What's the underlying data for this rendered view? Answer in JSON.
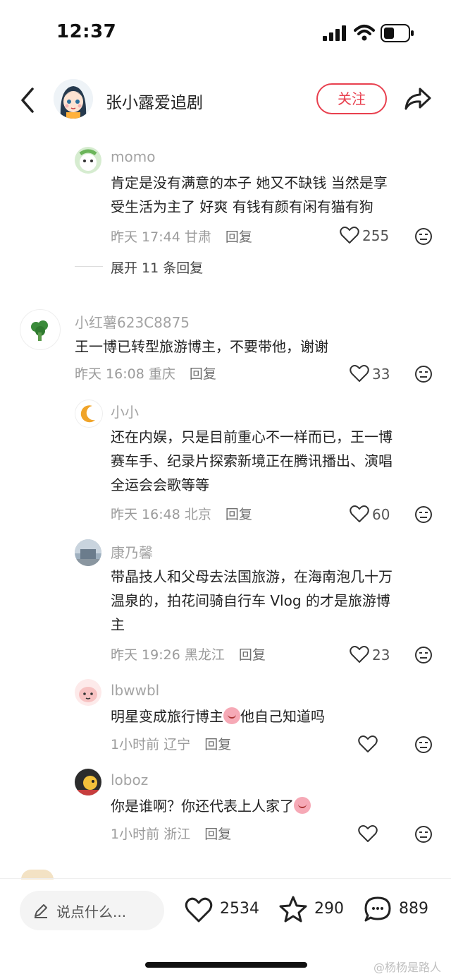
{
  "status": {
    "time": "12:37"
  },
  "header": {
    "username": "张小露爱追剧",
    "follow_label": "关注"
  },
  "comments": [
    {
      "user": "momo",
      "text_lines": [
        "肯定是没有满意的本子 她又不缺钱 当然是享",
        "受生活为主了 好爽 有钱有颜有闲有猫有狗"
      ],
      "time": "昨天 17:44",
      "location": "甘肃",
      "reply_label": "回复",
      "likes": "255"
    },
    {
      "user": "小红薯623C8875",
      "text_lines": [
        "王一博已转型旅游博主，不要带他，谢谢"
      ],
      "time": "昨天 16:08",
      "location": "重庆",
      "reply_label": "回复",
      "likes": "33"
    },
    {
      "user": "小小",
      "text_lines": [
        "还在内娱，只是目前重心不一样而已，王一博",
        "赛车手、纪录片探索新境正在腾讯播出、演唱",
        "全运会会歌等等"
      ],
      "time": "昨天 16:48",
      "location": "北京",
      "reply_label": "回复",
      "likes": "60"
    },
    {
      "user": "康乃馨",
      "text_lines": [
        "带晶技人和父母去法国旅游，在海南泡几十万",
        "温泉的，拍花间骑自行车 Vlog 的才是旅游博",
        "主"
      ],
      "time": "昨天 19:26",
      "location": "黑龙江",
      "reply_label": "回复",
      "likes": "23"
    },
    {
      "user": "lbwwbl",
      "text_a": "明星变成旅行博主",
      "text_b": "他自己知道吗",
      "time": "1小时前",
      "location": "辽宁",
      "reply_label": "回复"
    },
    {
      "user": "loboz",
      "text_a": "你是谁啊？你还代表上人家了",
      "time": "1小时前",
      "location": "浙江",
      "reply_label": "回复"
    }
  ],
  "expand_label": "展开 11 条回复",
  "bottom": {
    "placeholder": "说点什么...",
    "likes": "2534",
    "stars": "290",
    "comments": "889"
  },
  "watermark": "@杨杨是路人",
  "colors": {
    "accent": "#e8404f"
  }
}
